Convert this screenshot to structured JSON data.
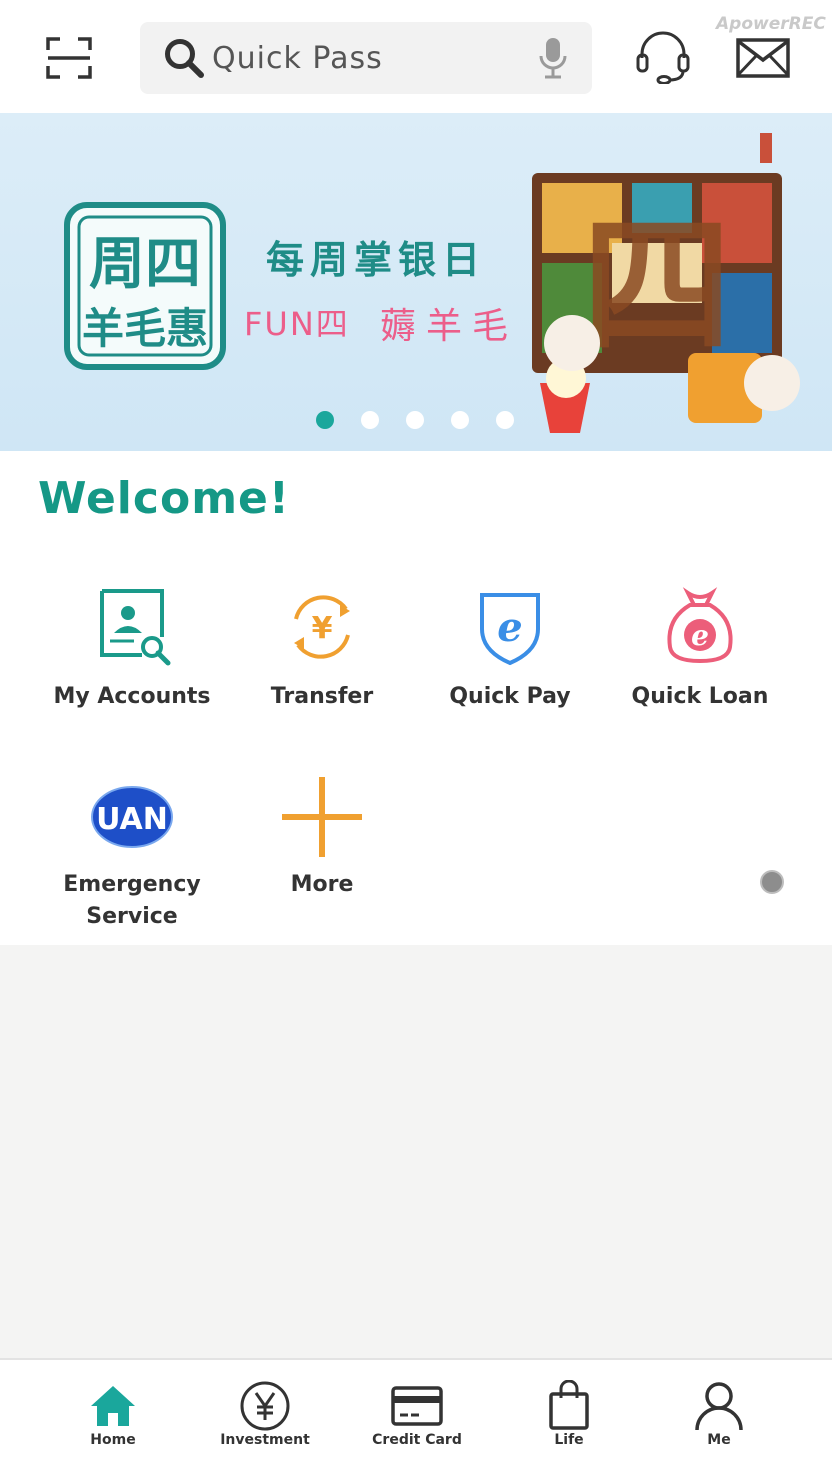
{
  "header": {
    "scan_icon": "scan-icon",
    "search": {
      "placeholder": "Quick Pass",
      "icon": "search-icon",
      "mic_icon": "microphone-icon"
    },
    "customer_service_icon": "headset-icon",
    "message_icon": "mail-icon",
    "watermark": "ApowerREC"
  },
  "banner": {
    "logo_text": "周四羊毛惠",
    "headline": "每周掌银日",
    "subline_left": "FUN四",
    "subline_right": "薅羊毛",
    "art_glyph": "四",
    "slide_count": 5,
    "active_slide": 1
  },
  "colors": {
    "accent": "#159886",
    "teal": "#1aa79c",
    "orange": "#f0a030",
    "blue": "#3a8ee6",
    "pink": "#ec5e7a",
    "navy": "#1e4fc8"
  },
  "welcome": {
    "title": "Welcome!"
  },
  "services": [
    {
      "label": "My Accounts",
      "icon": "account-search-icon"
    },
    {
      "label": "Transfer",
      "icon": "yuan-transfer-icon"
    },
    {
      "label": "Quick Pay",
      "icon": "e-shield-icon"
    },
    {
      "label": "Quick Loan",
      "icon": "e-money-bag-icon"
    },
    {
      "label": "Emergency\nService",
      "label_line1": "Emergency",
      "label_line2": "Service",
      "icon": "uan-globe-icon",
      "icon_text": "UAN"
    },
    {
      "label": "More",
      "icon": "plus-icon"
    }
  ],
  "tabbar": {
    "tabs": [
      {
        "label": "Home",
        "icon": "home-icon",
        "active": true
      },
      {
        "label": "Investment",
        "icon": "yuan-circle-icon",
        "active": false
      },
      {
        "label": "Credit Card",
        "icon": "credit-card-icon",
        "active": false
      },
      {
        "label": "Life",
        "icon": "shopping-bag-icon",
        "active": false
      },
      {
        "label": "Me",
        "icon": "user-icon",
        "active": false
      }
    ]
  }
}
